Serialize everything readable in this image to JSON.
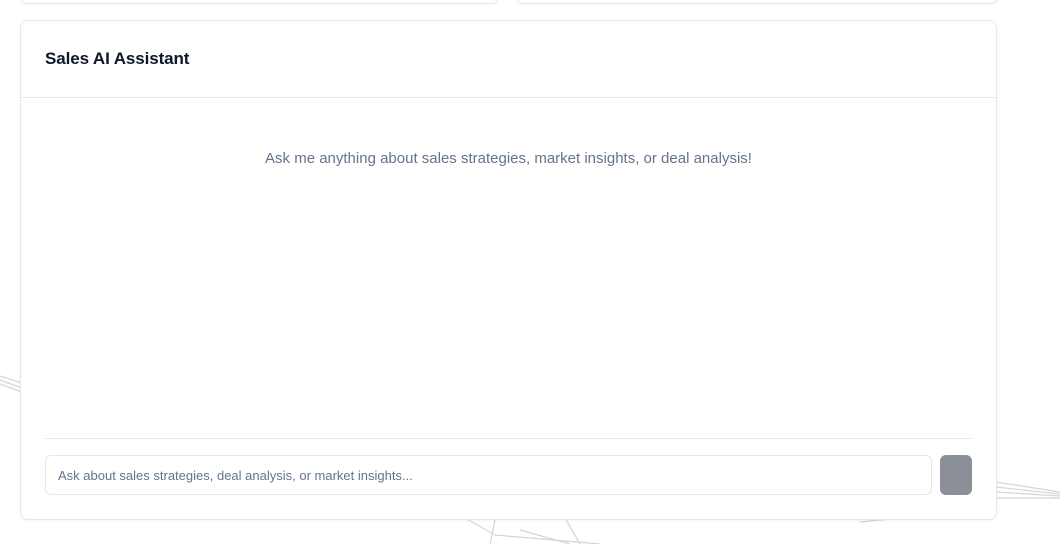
{
  "assistant": {
    "title": "Sales AI Assistant",
    "empty_message": "Ask me anything about sales strategies, market insights, or deal analysis!",
    "input": {
      "value": "",
      "placeholder": "Ask about sales strategies, deal analysis, or market insights..."
    },
    "send_button": {
      "label": "",
      "enabled": false
    }
  }
}
